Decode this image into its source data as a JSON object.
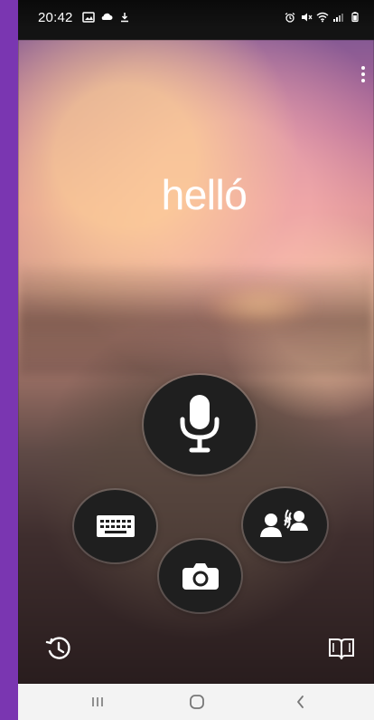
{
  "status_bar": {
    "time": "20:42",
    "left_icons": [
      "gallery-icon",
      "cloud-icon",
      "download-icon"
    ],
    "right_icons": [
      "alarm-icon",
      "mute-icon",
      "wifi-icon",
      "signal-icon",
      "battery-icon"
    ]
  },
  "app": {
    "top_menu_icon": "more-vertical-icon",
    "phrase": "helló",
    "actions": [
      {
        "name": "voice",
        "icon": "microphone-icon"
      },
      {
        "name": "keyboard",
        "icon": "keyboard-icon"
      },
      {
        "name": "camera",
        "icon": "camera-icon"
      },
      {
        "name": "conversation",
        "icon": "conversation-icon"
      }
    ],
    "bottom_left_icon": "history-icon",
    "bottom_right_icon": "phrasebook-icon"
  },
  "navigation": {
    "items": [
      "recent-apps-icon",
      "home-icon",
      "back-icon"
    ]
  },
  "colors": {
    "side_background": "#7a36b1",
    "button_fill": "#1f1f1f",
    "nav_bar": "#f3f3f3",
    "text": "#ffffff"
  }
}
